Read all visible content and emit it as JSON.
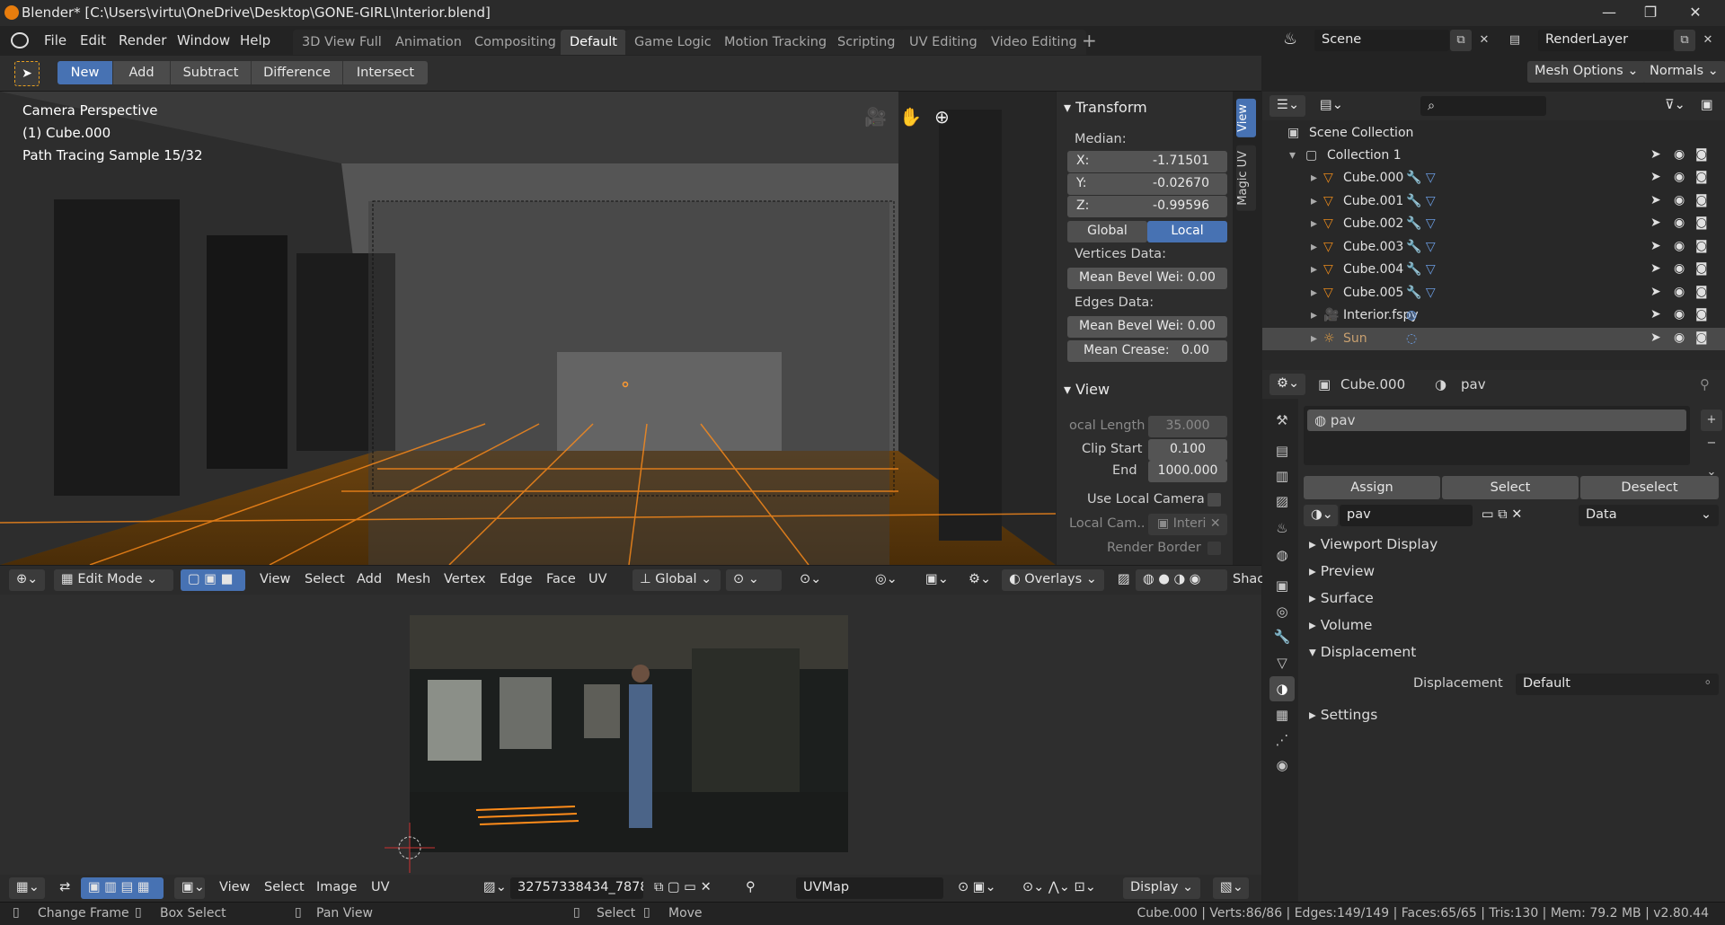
{
  "window": {
    "title": "Blender* [C:\\Users\\virtu\\OneDrive\\Desktop\\GONE-GIRL\\Interior.blend]",
    "minimize": "—",
    "maximize": "❐",
    "close": "✕"
  },
  "menubar": [
    "File",
    "Edit",
    "Render",
    "Window",
    "Help"
  ],
  "workspaces": [
    "3D View Full",
    "Animation",
    "Compositing",
    "Default",
    "Game Logic",
    "Motion Tracking",
    "Scripting",
    "UV Editing",
    "Video Editing"
  ],
  "active_workspace": "Default",
  "scene": {
    "name": "Scene",
    "render_layer": "RenderLayer"
  },
  "tool_header": {
    "modes": [
      "New",
      "Add",
      "Subtract",
      "Difference",
      "Intersect"
    ],
    "active": "New",
    "mesh_options": "Mesh Options",
    "normals": "Normals"
  },
  "viewport": {
    "info": [
      "Camera Perspective",
      "(1) Cube.000",
      "Path Tracing Sample 15/32"
    ]
  },
  "npanel": {
    "transform_title": "Transform",
    "median": "Median:",
    "x_label": "X:",
    "x": "-1.71501",
    "y_label": "Y:",
    "y": "-0.02670",
    "z_label": "Z:",
    "z": "-0.99596",
    "global": "Global",
    "local": "Local",
    "vertices_data": "Vertices Data:",
    "mean_bevel_vert": "Mean Bevel Wei: 0.00",
    "edges_data": "Edges Data:",
    "mean_bevel_edge": "Mean Bevel Wei: 0.00",
    "mean_crease_label": "Mean Crease:",
    "mean_crease": "0.00",
    "view_title": "View",
    "focal_length_label": "ocal Length",
    "focal_length": "35.000",
    "clip_start_label": "Clip Start",
    "clip_start": "0.100",
    "end_label": "End",
    "end": "1000.000",
    "use_local_camera": "Use Local Camera",
    "local_cam_label": "Local Cam..",
    "local_cam": "Interi",
    "render_border": "Render Border"
  },
  "sidebar_tabs": [
    "View",
    "Magic UV"
  ],
  "viewport_header": {
    "mode": "Edit Mode",
    "menus": [
      "View",
      "Select",
      "Add",
      "Mesh",
      "Vertex",
      "Edge",
      "Face",
      "UV"
    ],
    "orientation": "Global",
    "overlays": "Overlays",
    "shading": "Shac"
  },
  "uv_header": {
    "menus": [
      "View",
      "Select",
      "Image",
      "UV"
    ],
    "image": "32757338434_7878..",
    "uvmap": "UVMap",
    "display": "Display"
  },
  "outliner": {
    "root": "Scene Collection",
    "collection": "Collection 1",
    "items": [
      {
        "name": "Cube.000",
        "type": "mesh"
      },
      {
        "name": "Cube.001",
        "type": "mesh"
      },
      {
        "name": "Cube.002",
        "type": "mesh"
      },
      {
        "name": "Cube.003",
        "type": "mesh"
      },
      {
        "name": "Cube.004",
        "type": "mesh"
      },
      {
        "name": "Cube.005",
        "type": "mesh"
      },
      {
        "name": "Interior.fspy",
        "type": "camera"
      },
      {
        "name": "Sun",
        "type": "light"
      }
    ]
  },
  "properties": {
    "object": "Cube.000",
    "material": "pav",
    "slot": "pav",
    "assign": "Assign",
    "select": "Select",
    "deselect": "Deselect",
    "material_field": "pav",
    "link": "Data",
    "sections": [
      "Viewport Display",
      "Preview",
      "Surface",
      "Volume",
      "Displacement",
      "Settings"
    ],
    "displacement_label": "Displacement",
    "displacement_value": "Default"
  },
  "status_bar": {
    "items": [
      "Change Frame",
      "Box Select",
      "Pan View",
      "Select",
      "Move"
    ],
    "stats": "Cube.000 | Verts:86/86 | Edges:149/149 | Faces:65/65 | Tris:130 | Mem: 79.2 MB | v2.80.44"
  },
  "colors": {
    "accent": "#4772b3",
    "bg": "#232323",
    "panel": "#2d2d2d",
    "orange": "#e8891b",
    "selected_row": "#4a4a4a"
  }
}
